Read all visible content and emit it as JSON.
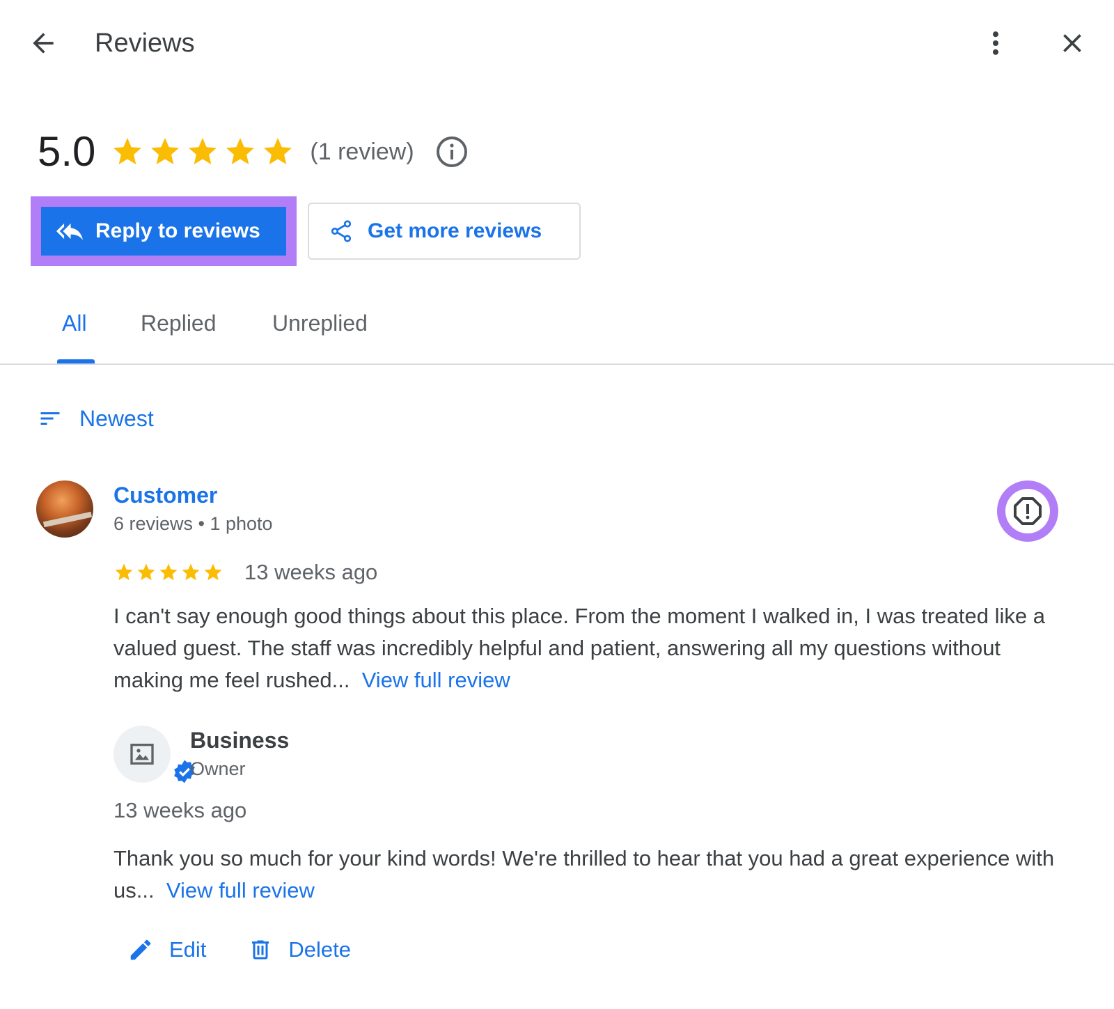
{
  "header": {
    "title": "Reviews",
    "icons": {
      "back": "arrow-left-icon",
      "more": "more-vert-icon",
      "close": "close-icon"
    }
  },
  "summary": {
    "rating": "5.0",
    "stars": 5,
    "count_text": "(1 review)",
    "star_color": "#fbbc04"
  },
  "actions": {
    "reply_label": "Reply to reviews",
    "get_more_label": "Get more reviews",
    "accent_color": "#1a73e8",
    "highlight_color": "#b27ef8"
  },
  "tabs": [
    {
      "label": "All",
      "active": true
    },
    {
      "label": "Replied",
      "active": false
    },
    {
      "label": "Unreplied",
      "active": false
    }
  ],
  "sort": {
    "label": "Newest"
  },
  "review": {
    "author": "Customer",
    "meta": "6 reviews • 1 photo",
    "stars": 5,
    "time": "13 weeks ago",
    "text": "I can't say enough good things about this place. From the moment I walked in, I was treated like a valued guest. The staff was incredibly helpful and patient, answering all my questions without making me feel rushed...",
    "view_full": "View full review"
  },
  "owner_reply": {
    "name": "Business",
    "role": "Owner",
    "time": "13 weeks ago",
    "text": "Thank you so much for your kind words! We're thrilled to hear that you had a great experience with us...",
    "view_full": "View full review",
    "edit_label": "Edit",
    "delete_label": "Delete"
  }
}
